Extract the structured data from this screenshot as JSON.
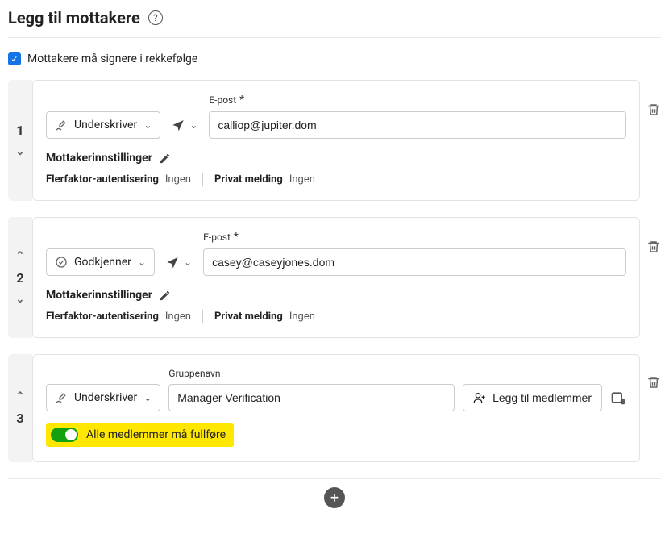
{
  "header": {
    "title": "Legg til mottakere"
  },
  "orderCheckbox": {
    "label": "Mottakere må signere i rekkefølge"
  },
  "labels": {
    "email": "E-post",
    "groupName": "Gruppenavn",
    "recipientSettings": "Mottakerinnstillinger",
    "mfa": "Flerfaktor-autentisering",
    "privateMessage": "Privat melding",
    "addMembers": "Legg til medlemmer",
    "allMustComplete": "Alle medlemmer må fullføre",
    "none": "Ingen"
  },
  "roles": {
    "signer": "Underskriver",
    "approver": "Godkjenner"
  },
  "recipients": [
    {
      "order": "1",
      "roleKey": "signer",
      "email": "calliop@jupiter.dom",
      "mfa": "Ingen",
      "privateMessage": "Ingen"
    },
    {
      "order": "2",
      "roleKey": "approver",
      "email": "casey@caseyjones.dom",
      "mfa": "Ingen",
      "privateMessage": "Ingen"
    }
  ],
  "group": {
    "order": "3",
    "roleKey": "signer",
    "name": "Manager Verification"
  }
}
